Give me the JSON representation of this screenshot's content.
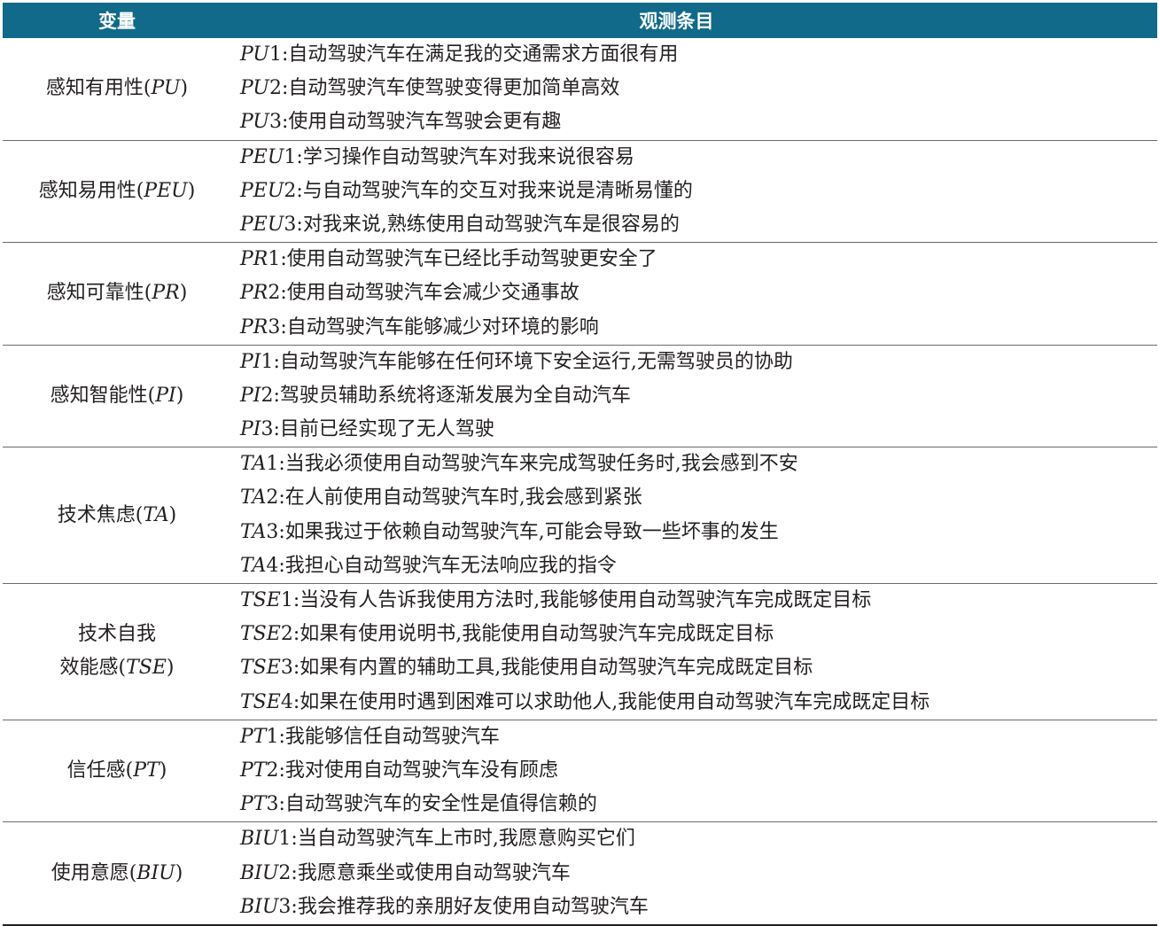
{
  "header": {
    "variable_label": "变量",
    "items_label": "观测条目"
  },
  "groups": [
    {
      "name_prefix": "感知有用性(",
      "abbr": "PU",
      "name_suffix": ")",
      "items": [
        {
          "code": "PU",
          "num": "1",
          "text": ":自动驾驶汽车在满足我的交通需求方面很有用"
        },
        {
          "code": "PU",
          "num": "2",
          "text": ":自动驾驶汽车使驾驶变得更加简单高效"
        },
        {
          "code": "PU",
          "num": "3",
          "text": ":使用自动驾驶汽车驾驶会更有趣"
        }
      ]
    },
    {
      "name_prefix": "感知易用性(",
      "abbr": "PEU",
      "name_suffix": ")",
      "items": [
        {
          "code": "PEU",
          "num": "1",
          "text": ":学习操作自动驾驶汽车对我来说很容易"
        },
        {
          "code": "PEU",
          "num": "2",
          "text": ":与自动驾驶汽车的交互对我来说是清晰易懂的"
        },
        {
          "code": "PEU",
          "num": "3",
          "text": ":对我来说,熟练使用自动驾驶汽车是很容易的"
        }
      ]
    },
    {
      "name_prefix": "感知可靠性(",
      "abbr": "PR",
      "name_suffix": ")",
      "items": [
        {
          "code": "PR",
          "num": "1",
          "text": ":使用自动驾驶汽车已经比手动驾驶更安全了"
        },
        {
          "code": "PR",
          "num": "2",
          "text": ":使用自动驾驶汽车会减少交通事故"
        },
        {
          "code": "PR",
          "num": "3",
          "text": ":自动驾驶汽车能够减少对环境的影响"
        }
      ]
    },
    {
      "name_prefix": "感知智能性(",
      "abbr": "PI",
      "name_suffix": ")",
      "items": [
        {
          "code": "PI",
          "num": "1",
          "text": ":自动驾驶汽车能够在任何环境下安全运行,无需驾驶员的协助"
        },
        {
          "code": "PI",
          "num": "2",
          "text": ":驾驶员辅助系统将逐渐发展为全自动汽车"
        },
        {
          "code": "PI",
          "num": "3",
          "text": ":目前已经实现了无人驾驶"
        }
      ]
    },
    {
      "name_prefix": "技术焦虑(",
      "abbr": "TA",
      "name_suffix": ")",
      "items": [
        {
          "code": "TA",
          "num": "1",
          "text": ":当我必须使用自动驾驶汽车来完成驾驶任务时,我会感到不安"
        },
        {
          "code": "TA",
          "num": "2",
          "text": ":在人前使用自动驾驶汽车时,我会感到紧张"
        },
        {
          "code": "TA",
          "num": "3",
          "text": ":如果我过于依赖自动驾驶汽车,可能会导致一些坏事的发生"
        },
        {
          "code": "TA",
          "num": "4",
          "text": ":我担心自动驾驶汽车无法响应我的指令"
        }
      ]
    },
    {
      "name_line1": "技术自我",
      "name_prefix": "效能感(",
      "abbr": "TSE",
      "name_suffix": ")",
      "items": [
        {
          "code": "TSE",
          "num": "1",
          "text": ":当没有人告诉我使用方法时,我能够使用自动驾驶汽车完成既定目标"
        },
        {
          "code": "TSE",
          "num": "2",
          "text": ":如果有使用说明书,我能使用自动驾驶汽车完成既定目标"
        },
        {
          "code": "TSE",
          "num": "3",
          "text": ":如果有内置的辅助工具,我能使用自动驾驶汽车完成既定目标"
        },
        {
          "code": "TSE",
          "num": "4",
          "text": ":如果在使用时遇到困难可以求助他人,我能使用自动驾驶汽车完成既定目标"
        }
      ]
    },
    {
      "name_prefix": "信任感(",
      "abbr": "PT",
      "name_suffix": ")",
      "items": [
        {
          "code": "PT",
          "num": "1",
          "text": ":我能够信任自动驾驶汽车"
        },
        {
          "code": "PT",
          "num": "2",
          "text": ":我对使用自动驾驶汽车没有顾虑"
        },
        {
          "code": "PT",
          "num": "3",
          "text": ":自动驾驶汽车的安全性是值得信赖的"
        }
      ]
    },
    {
      "name_prefix": "使用意愿(",
      "abbr": "BIU",
      "name_suffix": ")",
      "items": [
        {
          "code": "BIU",
          "num": "1",
          "text": ":当自动驾驶汽车上市时,我愿意购买它们"
        },
        {
          "code": "BIU",
          "num": "2",
          "text": ":我愿意乘坐或使用自动驾驶汽车"
        },
        {
          "code": "BIU",
          "num": "3",
          "text": ":我会推荐我的亲朋好友使用自动驾驶汽车"
        }
      ]
    }
  ]
}
